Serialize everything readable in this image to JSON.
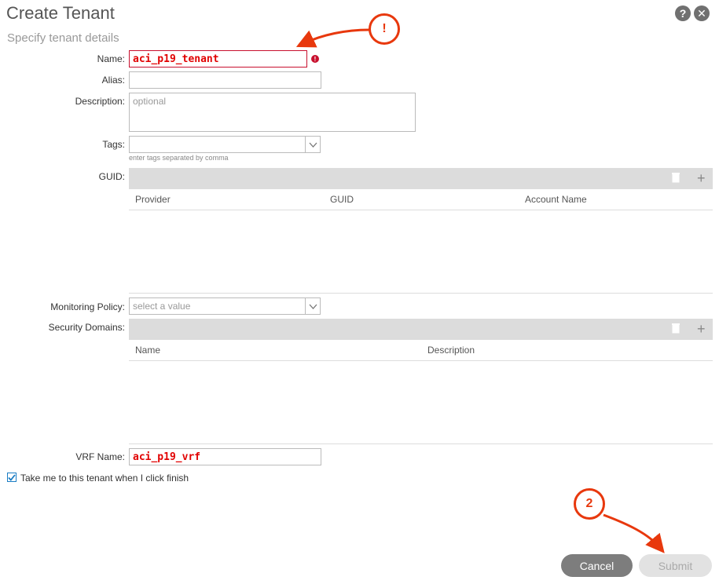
{
  "dialog": {
    "title": "Create Tenant",
    "subtitle": "Specify tenant details",
    "help_icon": "help-icon",
    "close_icon": "close-icon"
  },
  "form": {
    "name_label": "Name:",
    "name_value": "aci_p19_tenant",
    "alias_label": "Alias:",
    "alias_value": "",
    "description_label": "Description:",
    "description_placeholder": "optional",
    "tags_label": "Tags:",
    "tags_hint": "enter tags separated by comma",
    "guid_label": "GUID:",
    "guid_columns": [
      "Provider",
      "GUID",
      "Account Name"
    ],
    "monitoring_label": "Monitoring Policy:",
    "monitoring_placeholder": "select a value",
    "security_label": "Security Domains:",
    "security_columns": [
      "Name",
      "Description"
    ],
    "vrf_label": "VRF Name:",
    "vrf_value": "aci_p19_vrf",
    "checkbox_label": "Take me to this tenant when I click finish",
    "checkbox_checked": true
  },
  "buttons": {
    "cancel": "Cancel",
    "submit": "Submit"
  },
  "annotations": {
    "marker_1": "!",
    "marker_2": "2",
    "color": "#e8380d"
  }
}
